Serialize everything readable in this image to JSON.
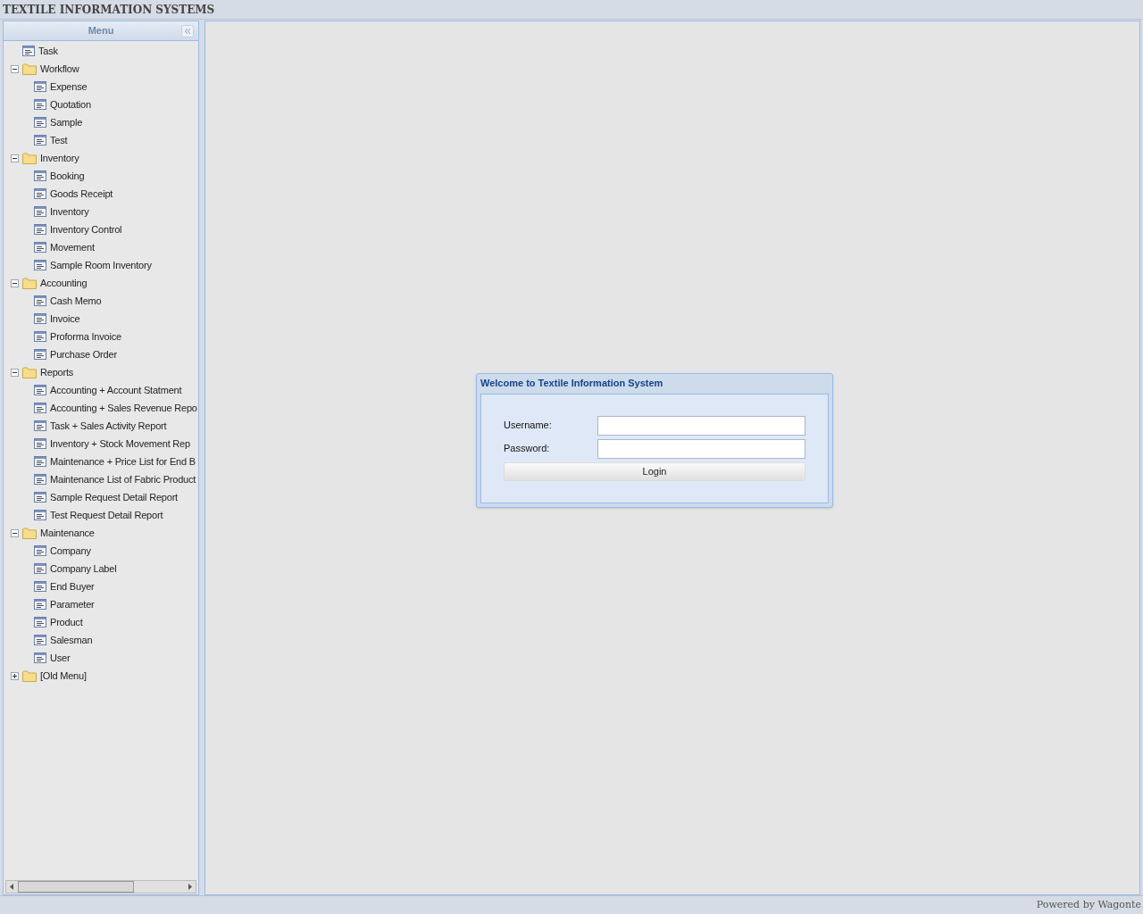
{
  "header": {
    "title": "TEXTILE INFORMATION SYSTEMS"
  },
  "menu": {
    "title": "Menu",
    "items": [
      {
        "kind": "leaf",
        "label": "Task"
      },
      {
        "kind": "folder",
        "label": "Workflow",
        "expanded": true,
        "children": [
          {
            "kind": "leaf",
            "label": "Expense"
          },
          {
            "kind": "leaf",
            "label": "Quotation"
          },
          {
            "kind": "leaf",
            "label": "Sample"
          },
          {
            "kind": "leaf",
            "label": "Test"
          }
        ]
      },
      {
        "kind": "folder",
        "label": "Inventory",
        "expanded": true,
        "children": [
          {
            "kind": "leaf",
            "label": "Booking"
          },
          {
            "kind": "leaf",
            "label": "Goods Receipt"
          },
          {
            "kind": "leaf",
            "label": "Inventory"
          },
          {
            "kind": "leaf",
            "label": "Inventory Control"
          },
          {
            "kind": "leaf",
            "label": "Movement"
          },
          {
            "kind": "leaf",
            "label": "Sample Room Inventory"
          }
        ]
      },
      {
        "kind": "folder",
        "label": "Accounting",
        "expanded": true,
        "children": [
          {
            "kind": "leaf",
            "label": "Cash Memo"
          },
          {
            "kind": "leaf",
            "label": "Invoice"
          },
          {
            "kind": "leaf",
            "label": "Proforma Invoice"
          },
          {
            "kind": "leaf",
            "label": "Purchase Order"
          }
        ]
      },
      {
        "kind": "folder",
        "label": "Reports",
        "expanded": true,
        "children": [
          {
            "kind": "leaf",
            "label": "Accounting + Account Statment"
          },
          {
            "kind": "leaf",
            "label": "Accounting + Sales Revenue Repo"
          },
          {
            "kind": "leaf",
            "label": "Task + Sales Activity Report"
          },
          {
            "kind": "leaf",
            "label": "Inventory + Stock Movement Rep"
          },
          {
            "kind": "leaf",
            "label": "Maintenance + Price List for End B"
          },
          {
            "kind": "leaf",
            "label": "Maintenance List of Fabric Product"
          },
          {
            "kind": "leaf",
            "label": "Sample Request Detail Report"
          },
          {
            "kind": "leaf",
            "label": "Test Request Detail Report"
          }
        ]
      },
      {
        "kind": "folder",
        "label": "Maintenance",
        "expanded": true,
        "children": [
          {
            "kind": "leaf",
            "label": "Company"
          },
          {
            "kind": "leaf",
            "label": "Company Label"
          },
          {
            "kind": "leaf",
            "label": "End Buyer"
          },
          {
            "kind": "leaf",
            "label": "Parameter"
          },
          {
            "kind": "leaf",
            "label": "Product"
          },
          {
            "kind": "leaf",
            "label": "Salesman"
          },
          {
            "kind": "leaf",
            "label": "User"
          }
        ]
      },
      {
        "kind": "folder",
        "label": "[Old Menu]",
        "expanded": false
      }
    ]
  },
  "login": {
    "title": "Welcome to Textile Information System",
    "fields": [
      {
        "label": "Username:"
      },
      {
        "label": "Password:"
      }
    ],
    "button": "Login"
  },
  "footer": {
    "text": "Powered by Wagonte"
  }
}
